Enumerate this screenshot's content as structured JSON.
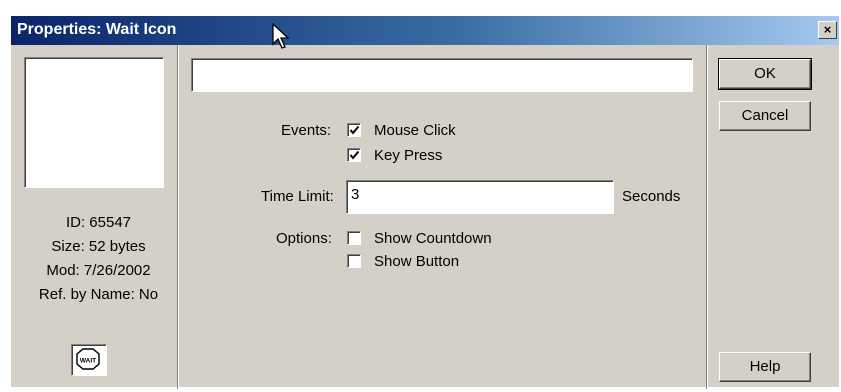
{
  "window": {
    "title": "Properties: Wait Icon",
    "close_label": "×"
  },
  "info": {
    "id": "ID: 65547",
    "size": "Size: 52 bytes",
    "mod": "Mod: 7/26/2002",
    "ref": "Ref. by Name: No",
    "icon_text": "WAIT"
  },
  "name_field": {
    "value": ""
  },
  "events": {
    "label": "Events:",
    "mouse_click": {
      "label": "Mouse Click",
      "checked": true
    },
    "key_press": {
      "label": "Key Press",
      "checked": true
    }
  },
  "time_limit": {
    "label": "Time Limit:",
    "value": "3",
    "unit": "Seconds"
  },
  "options": {
    "label": "Options:",
    "show_countdown": {
      "label": "Show Countdown",
      "checked": false
    },
    "show_button": {
      "label": "Show Button",
      "checked": false
    }
  },
  "buttons": {
    "ok": "OK",
    "cancel": "Cancel",
    "help": "Help"
  },
  "colors": {
    "dialog_bg": "#d4d0c8",
    "title_start": "#0a246a",
    "title_end": "#a6caf0"
  }
}
